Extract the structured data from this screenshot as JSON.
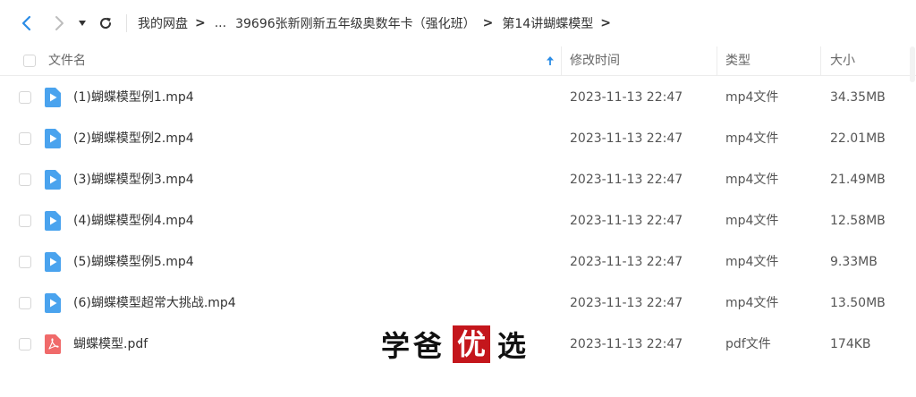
{
  "breadcrumb": {
    "root": "我的网盘",
    "ellipsis": "...",
    "folder": "39696张新刚新五年级奥数年卡（强化班）",
    "current": "第14讲蝴蝶模型",
    "separator": ">"
  },
  "header": {
    "name": "文件名",
    "modified": "修改时间",
    "type": "类型",
    "size": "大小"
  },
  "files": [
    {
      "name": "(1)蝴蝶模型例1.mp4",
      "date": "2023-11-13 22:47",
      "type": "mp4文件",
      "size": "34.35MB",
      "icon": "video-file-icon"
    },
    {
      "name": "(2)蝴蝶模型例2.mp4",
      "date": "2023-11-13 22:47",
      "type": "mp4文件",
      "size": "22.01MB",
      "icon": "video-file-icon"
    },
    {
      "name": "(3)蝴蝶模型例3.mp4",
      "date": "2023-11-13 22:47",
      "type": "mp4文件",
      "size": "21.49MB",
      "icon": "video-file-icon"
    },
    {
      "name": "(4)蝴蝶模型例4.mp4",
      "date": "2023-11-13 22:47",
      "type": "mp4文件",
      "size": "12.58MB",
      "icon": "video-file-icon"
    },
    {
      "name": "(5)蝴蝶模型例5.mp4",
      "date": "2023-11-13 22:47",
      "type": "mp4文件",
      "size": "9.33MB",
      "icon": "video-file-icon"
    },
    {
      "name": "(6)蝴蝶模型超常大挑战.mp4",
      "date": "2023-11-13 22:47",
      "type": "mp4文件",
      "size": "13.50MB",
      "icon": "video-file-icon"
    },
    {
      "name": "蝴蝶模型.pdf",
      "date": "2023-11-13 22:47",
      "type": "pdf文件",
      "size": "174KB",
      "icon": "pdf-file-icon"
    }
  ],
  "watermark": {
    "left": "学爸",
    "red": "优",
    "right": "选"
  },
  "colors": {
    "accent": "#2b8ce6",
    "video_icon": "#4aa3ee",
    "pdf_icon": "#f06a6a",
    "watermark_red": "#c4161c"
  }
}
